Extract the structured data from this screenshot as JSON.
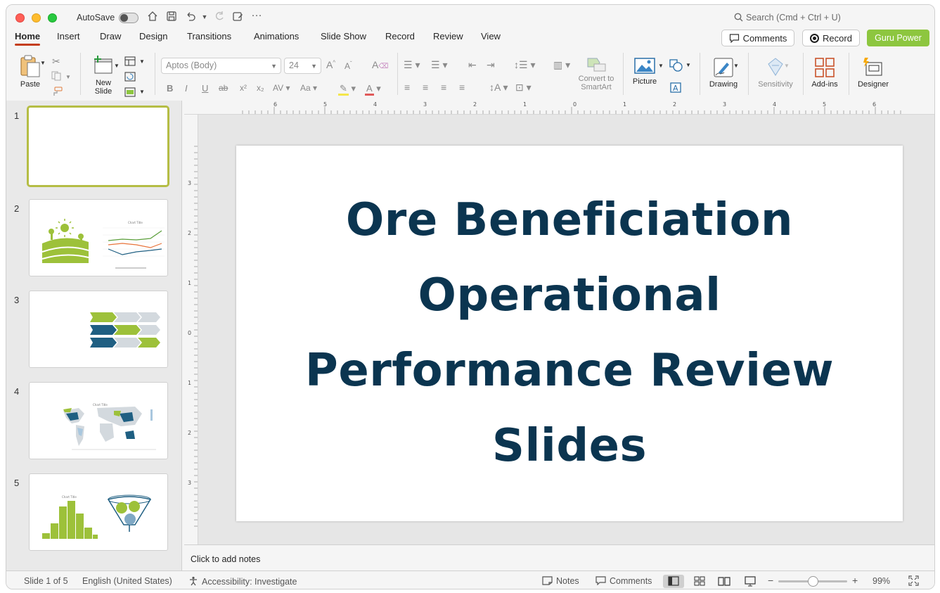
{
  "titlebar": {
    "autosave_label": "AutoSave",
    "search_placeholder": "Search (Cmd + Ctrl + U)"
  },
  "tabs": [
    "Home",
    "Insert",
    "Draw",
    "Design",
    "Transitions",
    "Animations",
    "Slide Show",
    "Record",
    "Review",
    "View"
  ],
  "active_tab": "Home",
  "header_buttons": {
    "comments": "Comments",
    "record": "Record",
    "guru": "Guru Power"
  },
  "ribbon": {
    "paste": "Paste",
    "new_slide_line1": "New",
    "new_slide_line2": "Slide",
    "font_name": "Aptos (Body)",
    "font_size": "24",
    "convert_line1": "Convert to",
    "convert_line2": "SmartArt",
    "picture": "Picture",
    "drawing": "Drawing",
    "sensitivity": "Sensitivity",
    "addins": "Add-ins",
    "designer": "Designer"
  },
  "slides": [
    {
      "num": "1"
    },
    {
      "num": "2"
    },
    {
      "num": "3"
    },
    {
      "num": "4"
    },
    {
      "num": "5"
    }
  ],
  "slide": {
    "title": "Ore Beneficiation Operational Performance Review Slides",
    "title_color": "#0b3550"
  },
  "ruler_top_labels": [
    "6",
    "5",
    "4",
    "3",
    "2",
    "1",
    "0",
    "1",
    "2",
    "3",
    "4",
    "5",
    "6"
  ],
  "ruler_left_labels": [
    "3",
    "2",
    "1",
    "0",
    "1",
    "2",
    "3"
  ],
  "notes_placeholder": "Click to add notes",
  "status": {
    "slide_of": "Slide 1 of 5",
    "language": "English (United States)",
    "accessibility": "Accessibility: Investigate",
    "notes": "Notes",
    "comments": "Comments",
    "zoom": "99%"
  },
  "colors": {
    "accent_tab": "#c43e1c",
    "guru_green": "#8dc63f",
    "thumb_green": "#9dc13a",
    "thumb_navy": "#1f5f82",
    "thumb_grey": "#d3d9de"
  }
}
